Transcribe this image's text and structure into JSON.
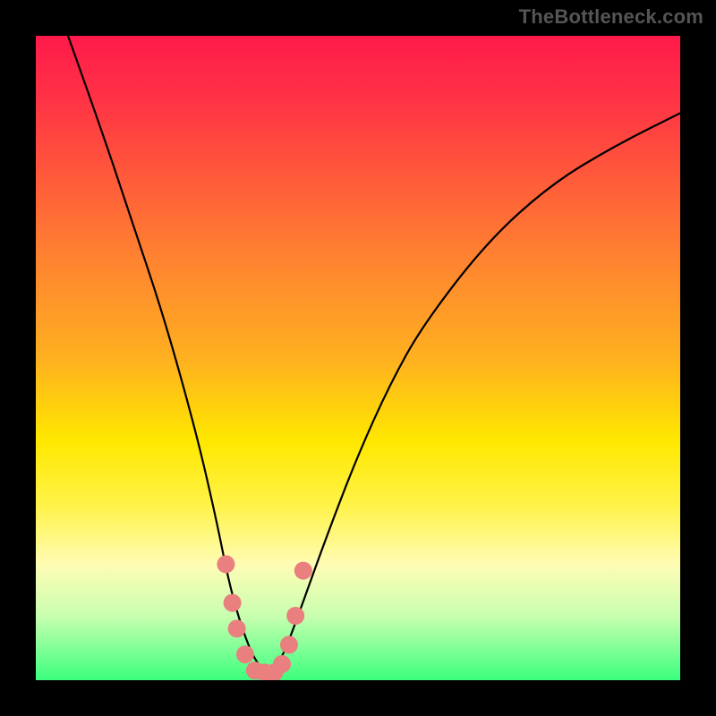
{
  "watermark": "TheBottleneck.com",
  "chart_data": {
    "type": "line",
    "title": "",
    "xlabel": "",
    "ylabel": "",
    "xlim": [
      0,
      100
    ],
    "ylim": [
      0,
      100
    ],
    "grid": false,
    "legend": false,
    "series": [
      {
        "name": "bottleneck-curve",
        "x": [
          5,
          10,
          15,
          20,
          25,
          28,
          30,
          32,
          34,
          36,
          38,
          40,
          45,
          50,
          55,
          60,
          70,
          80,
          90,
          100
        ],
        "y": [
          100,
          86,
          71,
          56,
          38,
          25,
          15,
          8,
          3,
          1,
          3,
          8,
          22,
          35,
          46,
          55,
          68,
          77,
          83,
          88
        ]
      }
    ],
    "markers": {
      "name": "highlight-region",
      "color": "#e97f7f",
      "points": [
        {
          "x": 29.5,
          "y": 18
        },
        {
          "x": 30.5,
          "y": 12
        },
        {
          "x": 31.2,
          "y": 8
        },
        {
          "x": 32.5,
          "y": 4
        },
        {
          "x": 34.0,
          "y": 1.5
        },
        {
          "x": 35.5,
          "y": 1.2
        },
        {
          "x": 37.0,
          "y": 1.2
        },
        {
          "x": 38.2,
          "y": 2.5
        },
        {
          "x": 39.3,
          "y": 5.5
        },
        {
          "x": 40.3,
          "y": 10
        },
        {
          "x": 41.5,
          "y": 17
        }
      ]
    },
    "gradient_stops": [
      {
        "pos": 0,
        "color": "#ff1a4b"
      },
      {
        "pos": 63,
        "color": "#ffe800"
      },
      {
        "pos": 100,
        "color": "#3bff7d"
      }
    ]
  }
}
